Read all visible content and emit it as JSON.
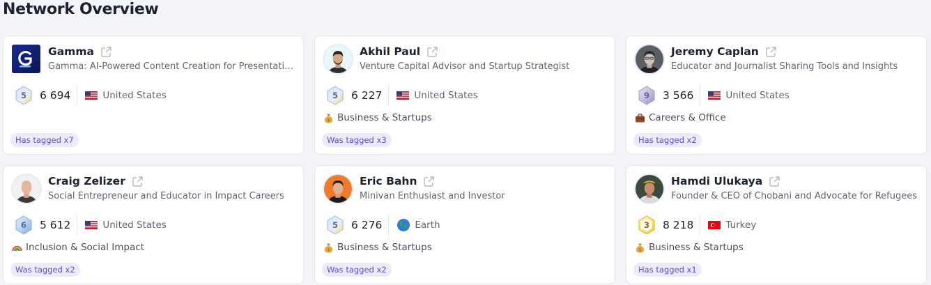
{
  "page": {
    "title": "Network Overview"
  },
  "colors": {
    "accent": "#5b4fc9",
    "tag_bg": "#ecebfc",
    "card_bg": "#ffffff",
    "page_bg": "#f3f4f8"
  },
  "cards": [
    {
      "name": "Gamma",
      "description": "Gamma: AI-Powered Content Creation for Presentations",
      "level": "5",
      "followers": "6 694",
      "country": "United States",
      "flag": "us-flag-icon",
      "category": "",
      "category_icon": "",
      "tag": "Has tagged x7"
    },
    {
      "name": "Akhil Paul",
      "description": "Venture Capital Advisor and Startup Strategist",
      "level": "5",
      "followers": "6 227",
      "country": "United States",
      "flag": "us-flag-icon",
      "category": "Business & Startups",
      "category_icon": "money-bag-icon",
      "tag": "Was tagged x3"
    },
    {
      "name": "Jeremy Caplan",
      "description": "Educator and Journalist Sharing Tools and Insights",
      "level": "9",
      "followers": "3 566",
      "country": "United States",
      "flag": "us-flag-icon",
      "category": "Careers & Office",
      "category_icon": "briefcase-icon",
      "tag": "Has tagged x2"
    },
    {
      "name": "Craig Zelizer",
      "description": "Social Entrepreneur and Educator in Impact Careers",
      "level": "6",
      "followers": "5 612",
      "country": "United States",
      "flag": "us-flag-icon",
      "category": "Inclusion & Social Impact",
      "category_icon": "rainbow-icon",
      "tag": "Was tagged x2"
    },
    {
      "name": "Eric Bahn",
      "description": "Minivan Enthusiast and Investor",
      "level": "5",
      "followers": "6 276",
      "country": "Earth",
      "flag": "globe-icon",
      "category": "Business & Startups",
      "category_icon": "money-bag-icon",
      "tag": "Was tagged x2"
    },
    {
      "name": "Hamdi Ulukaya",
      "description": "Founder & CEO of Chobani and Advocate for Refugees",
      "level": "3",
      "followers": "8 218",
      "country": "Turkey",
      "flag": "turkey-flag-icon",
      "category": "Business & Startups",
      "category_icon": "money-bag-icon",
      "tag": "Has tagged x1"
    }
  ]
}
